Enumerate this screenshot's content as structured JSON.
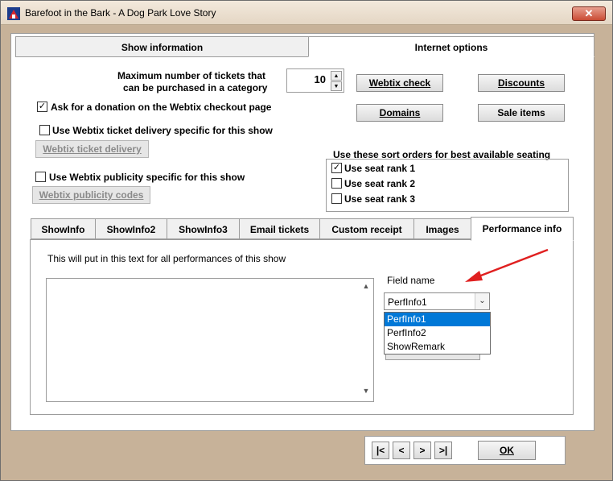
{
  "window": {
    "title": "Barefoot in the Bark - A Dog Park Love Story",
    "close_label": "✕"
  },
  "outer_tabs": [
    {
      "label": "Show information",
      "active": false
    },
    {
      "label": "Internet options",
      "active": true
    }
  ],
  "tickets": {
    "label_line1": "Maximum number of tickets that",
    "label_line2": "can be purchased in a category",
    "value": "10",
    "up_icon": "▲",
    "down_icon": "▼"
  },
  "buttons": {
    "webtix_check": "Webtix check",
    "discounts": "Discounts",
    "domains": "Domains",
    "sale_items": "Sale items",
    "webtix_ticket_delivery": "Webtix ticket delivery",
    "webtix_publicity_codes": "Webtix publicity codes"
  },
  "checkboxes": {
    "donation": {
      "label": "Ask for a donation on the Webtix checkout page",
      "checked": true
    },
    "ticket_delivery": {
      "label": "Use Webtix ticket delivery specific for this show",
      "checked": false
    },
    "publicity": {
      "label": "Use Webtix publicity specific for this show",
      "checked": false
    }
  },
  "sort_orders": {
    "heading": "Use these sort orders for best available seating",
    "items": [
      {
        "label": "Use seat rank 1",
        "checked": true
      },
      {
        "label": "Use seat rank 2",
        "checked": false
      },
      {
        "label": "Use seat rank 3",
        "checked": false
      }
    ]
  },
  "check_mark": "✓",
  "inner_tabs": [
    {
      "label": "ShowInfo"
    },
    {
      "label": "ShowInfo2"
    },
    {
      "label": "ShowInfo3"
    },
    {
      "label": "Email tickets"
    },
    {
      "label": "Custom receipt"
    },
    {
      "label": "Images"
    },
    {
      "label": "Performance info"
    }
  ],
  "performance": {
    "description": "This will put in this text for all performances of this show",
    "field_name_label": "Field name",
    "field_value": "PerfInfo1",
    "dropdown_arrow": "⌄",
    "options": [
      "PerfInfo1",
      "PerfInfo2",
      "ShowRemark"
    ],
    "scroll_up": "▲",
    "scroll_down": "▼"
  },
  "nav": {
    "first": "|<",
    "prev": "<",
    "next": ">",
    "last": ">|",
    "ok": "OK"
  },
  "colors": {
    "frame": "#c7b299",
    "selection": "#0078d7",
    "annotation_arrow": "#e02020"
  }
}
